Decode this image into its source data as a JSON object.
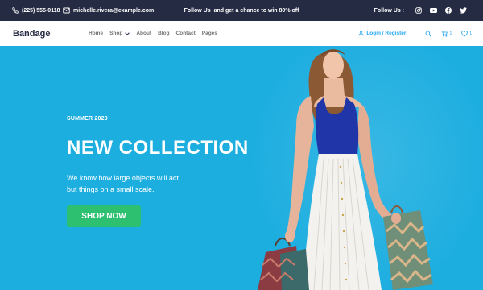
{
  "topbar": {
    "phone": "(225) 555-0118",
    "email": "michelle.rivera@example.com",
    "promo_prefix": "Follow Us",
    "promo_text": "and get a chance to win 80% off",
    "follow_label": "Follow Us :",
    "social_icons": [
      "instagram-icon",
      "youtube-icon",
      "facebook-icon",
      "twitter-icon"
    ]
  },
  "navbar": {
    "brand": "Bandage",
    "menu": [
      {
        "label": "Home"
      },
      {
        "label": "Shop",
        "has_dropdown": true
      },
      {
        "label": "About"
      },
      {
        "label": "Blog"
      },
      {
        "label": "Contact"
      },
      {
        "label": "Pages"
      }
    ],
    "login_label": "Login / Register",
    "cart_count": "1",
    "wishlist_count": "1"
  },
  "hero": {
    "eyebrow": "SUMMER 2020",
    "headline": "NEW COLLECTION",
    "description_line1": "We know how large objects will act,",
    "description_line2": "but things on a small scale.",
    "cta_label": "SHOP NOW"
  },
  "colors": {
    "topbar_bg": "#252b42",
    "hero_bg": "#1daee0",
    "accent": "#23a6f0",
    "cta_bg": "#2dc071",
    "nav_text": "#737373"
  }
}
